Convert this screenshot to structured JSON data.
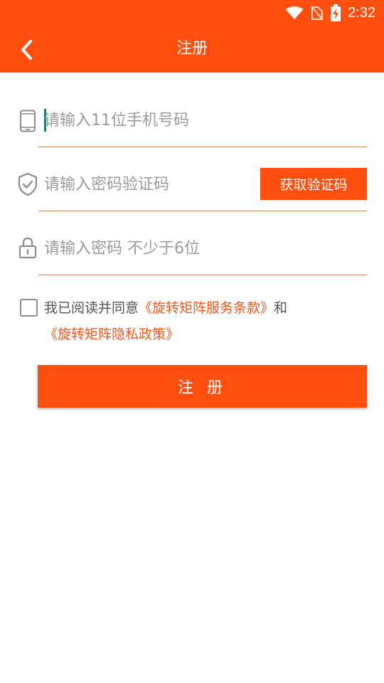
{
  "status_bar": {
    "time": "2:32",
    "icons": [
      "wifi-icon",
      "no-sim-icon",
      "battery-charging-icon"
    ]
  },
  "header": {
    "title": "注册",
    "back_icon": "chevron-left-icon"
  },
  "form": {
    "phone": {
      "placeholder": "请输入11位手机号码",
      "icon": "phone-icon",
      "value": ""
    },
    "code": {
      "placeholder": "请输入密码验证码",
      "icon": "shield-check-icon",
      "value": "",
      "button_label": "获取验证码"
    },
    "password": {
      "placeholder": "请输入密码 不少于6位",
      "icon": "lock-icon",
      "value": ""
    }
  },
  "agreement": {
    "checked": false,
    "prefix": "我已阅读并同意",
    "terms_link": "《旋转矩阵服务条款》",
    "connector": "和",
    "privacy_link": "《旋转矩阵隐私政策》"
  },
  "submit_label": "注 册",
  "colors": {
    "primary": "#ff4e0e",
    "link": "#f0571d",
    "underline": "#c9865e",
    "placeholder": "#9a9a9a"
  }
}
